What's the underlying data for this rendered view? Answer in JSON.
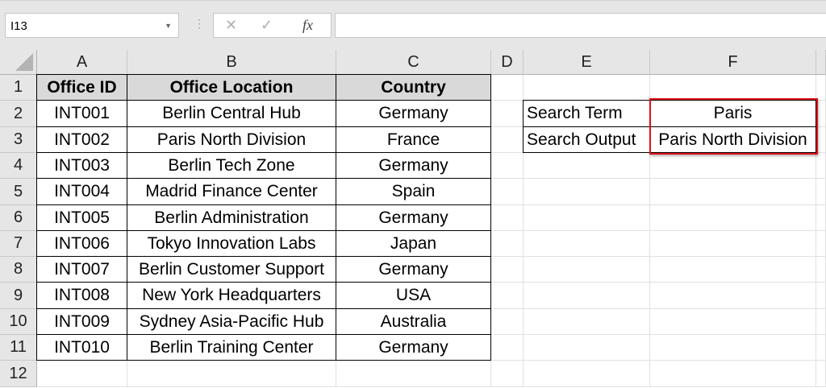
{
  "formula_bar": {
    "name_box": "I13",
    "cancel_icon": "✕",
    "enter_icon": "✓",
    "fx_label": "fx",
    "formula": ""
  },
  "columns": [
    "A",
    "B",
    "C",
    "D",
    "E",
    "F",
    ""
  ],
  "rows": [
    "1",
    "2",
    "3",
    "4",
    "5",
    "6",
    "7",
    "8",
    "9",
    "10",
    "11",
    "12"
  ],
  "table": {
    "headers": [
      "Office ID",
      "Office Location",
      "Country"
    ],
    "data": [
      [
        "INT001",
        "Berlin Central Hub",
        "Germany"
      ],
      [
        "INT002",
        "Paris North Division",
        "France"
      ],
      [
        "INT003",
        "Berlin Tech Zone",
        "Germany"
      ],
      [
        "INT004",
        "Madrid Finance Center",
        "Spain"
      ],
      [
        "INT005",
        "Berlin Administration",
        "Germany"
      ],
      [
        "INT006",
        "Tokyo Innovation Labs",
        "Japan"
      ],
      [
        "INT007",
        "Berlin Customer Support",
        "Germany"
      ],
      [
        "INT008",
        "New York Headquarters",
        "USA"
      ],
      [
        "INT009",
        "Sydney Asia-Pacific Hub",
        "Australia"
      ],
      [
        "INT010",
        "Berlin Training Center",
        "Germany"
      ]
    ]
  },
  "search": {
    "term_label": "Search Term",
    "term_value": "Paris",
    "output_label": "Search Output",
    "output_value": "Paris North Division"
  },
  "colors": {
    "highlight": "#e0101a",
    "header_fill": "#d9d9d9"
  }
}
